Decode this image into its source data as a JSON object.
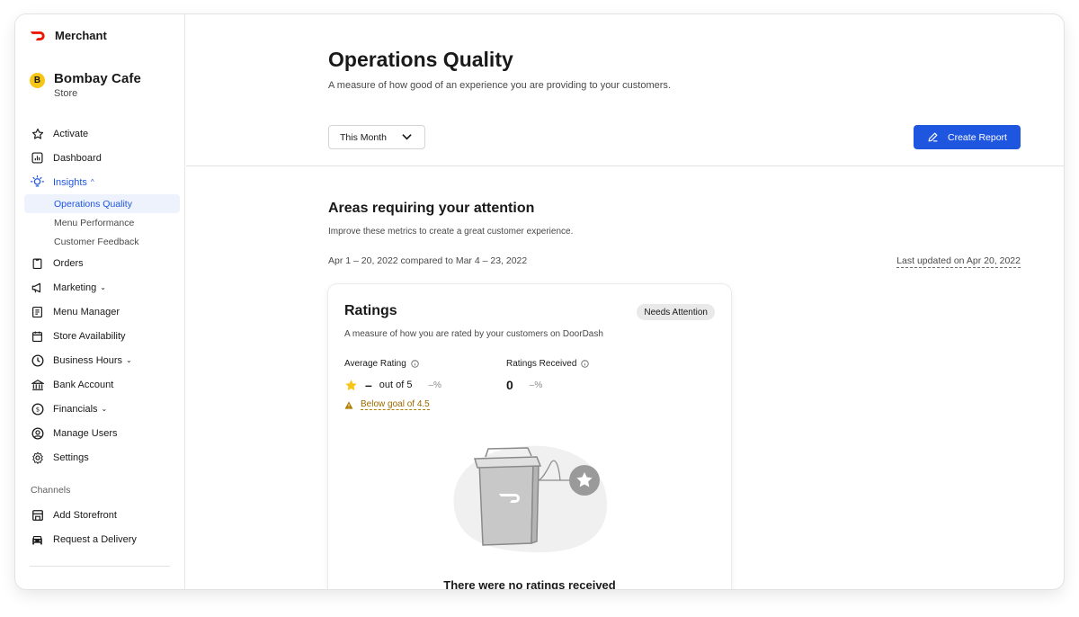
{
  "app": {
    "brand": "Merchant",
    "accent": "#1f56e0",
    "logo_color": "#eb1700"
  },
  "store": {
    "initial": "B",
    "name": "Bombay Cafe",
    "type": "Store"
  },
  "sidebar": {
    "items": [
      {
        "label": "Activate",
        "icon": "star-icon"
      },
      {
        "label": "Dashboard",
        "icon": "chart-icon"
      },
      {
        "label": "Insights",
        "icon": "lightbulb-icon",
        "caret": "^"
      },
      {
        "label": "Orders",
        "icon": "clipboard-icon"
      },
      {
        "label": "Marketing",
        "icon": "megaphone-icon",
        "caret": "⌄"
      },
      {
        "label": "Menu Manager",
        "icon": "menu-icon"
      },
      {
        "label": "Store Availability",
        "icon": "calendar-icon"
      },
      {
        "label": "Business Hours",
        "icon": "clock-icon",
        "caret": "⌄"
      },
      {
        "label": "Bank Account",
        "icon": "bank-icon"
      },
      {
        "label": "Financials",
        "icon": "dollar-icon",
        "caret": "⌄"
      },
      {
        "label": "Manage Users",
        "icon": "user-circle-icon"
      },
      {
        "label": "Settings",
        "icon": "gear-icon"
      }
    ],
    "insights_sub": [
      "Operations Quality",
      "Menu Performance",
      "Customer Feedback"
    ],
    "channels_label": "Channels",
    "channels": [
      {
        "label": "Add Storefront",
        "icon": "storefront-icon"
      },
      {
        "label": "Request a Delivery",
        "icon": "car-icon"
      }
    ]
  },
  "header": {
    "title": "Operations Quality",
    "subtitle": "A measure of how good of an experience you are providing to your customers.",
    "period": "This Month",
    "create_report": "Create Report"
  },
  "attention": {
    "title": "Areas requiring your attention",
    "subtitle": "Improve these metrics to create a great customer experience.",
    "compare": "Apr 1 – 20, 2022 compared to Mar 4 – 23, 2022",
    "updated": "Last updated on Apr 20, 2022"
  },
  "ratings": {
    "title": "Ratings",
    "badge": "Needs Attention",
    "subtitle": "A measure of how you are rated by your customers on DoorDash",
    "avg_label": "Average Rating",
    "avg_value": "–",
    "avg_suffix": "out of 5",
    "avg_delta": "–%",
    "received_label": "Ratings Received",
    "received_value": "0",
    "received_delta": "–%",
    "goal_text": "Below goal of 4.5",
    "empty": "There were no ratings received"
  }
}
